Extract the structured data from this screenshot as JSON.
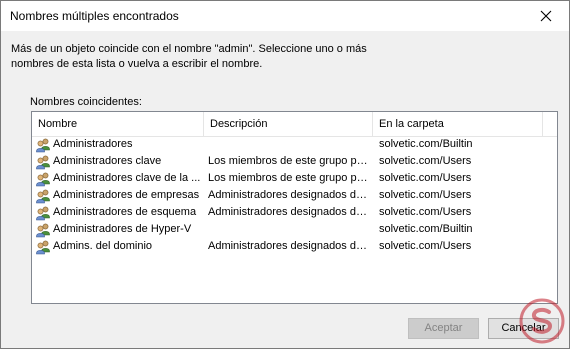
{
  "window": {
    "title": "Nombres múltiples encontrados",
    "close_symbol": "✕"
  },
  "message": {
    "line1": "Más de un objeto coincide con el nombre \"admin\". Seleccione uno o más",
    "line2": "nombres de esta lista o vuelva a escribir el nombre."
  },
  "list": {
    "label": "Nombres coincidentes:",
    "columns": [
      "Nombre",
      "Descripción",
      "En la carpeta"
    ],
    "rows": [
      {
        "name": "Administradores",
        "description": "",
        "folder": "solvetic.com/Builtin"
      },
      {
        "name": "Administradores clave",
        "description": "Los miembros de este grupo pu...",
        "folder": "solvetic.com/Users"
      },
      {
        "name": "Administradores clave de la ...",
        "description": "Los miembros de este grupo pu...",
        "folder": "solvetic.com/Users"
      },
      {
        "name": "Administradores de empresas",
        "description": "Administradores designados de ...",
        "folder": "solvetic.com/Users"
      },
      {
        "name": "Administradores de esquema",
        "description": "Administradores designados del...",
        "folder": "solvetic.com/Users"
      },
      {
        "name": "Administradores de Hyper-V",
        "description": "",
        "folder": "solvetic.com/Builtin"
      },
      {
        "name": "Admins. del dominio",
        "description": "Administradores designados del...",
        "folder": "solvetic.com/Users"
      }
    ]
  },
  "buttons": {
    "accept": "Aceptar",
    "cancel": "Cancelar"
  },
  "icons": {
    "row_icon": "user-group-icon",
    "close": "close-icon",
    "watermark": "solvetic-logo"
  }
}
